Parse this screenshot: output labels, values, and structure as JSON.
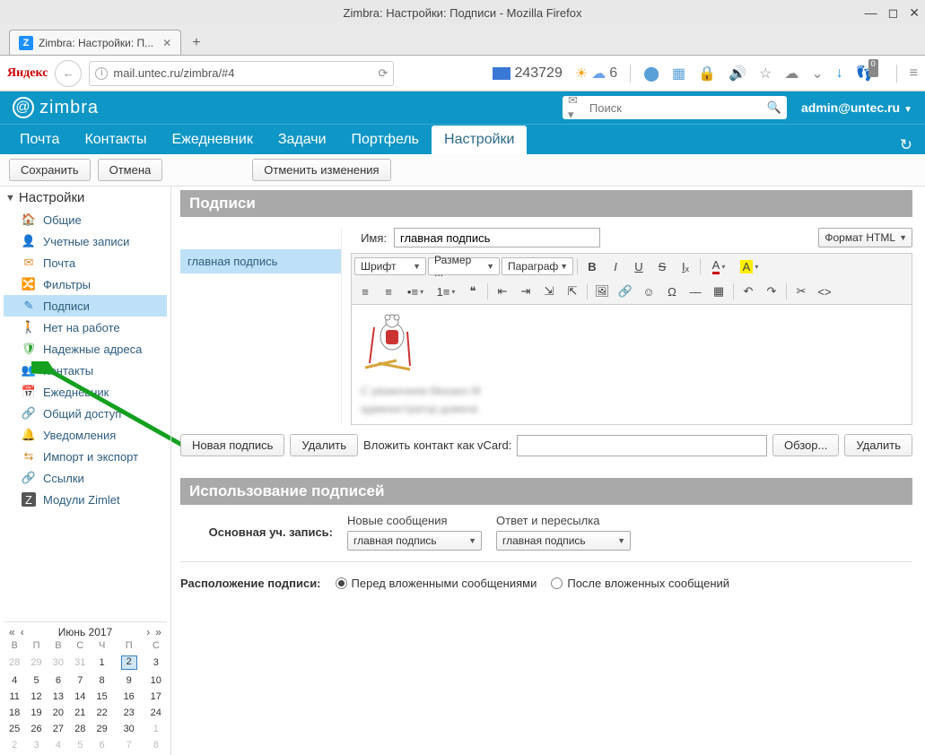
{
  "window": {
    "title": "Zimbra: Настройки: Подписи - Mozilla Firefox"
  },
  "browser": {
    "tab_title": "Zimbra: Настройки: П...",
    "yandex": "Яндекс",
    "url_display": "mail.untec.ru/zimbra/#4",
    "unread_badge": "243729",
    "weather_temp": "6",
    "ext_badge": "0"
  },
  "zimbra": {
    "logo": "zimbra",
    "search_placeholder": "Поиск",
    "user": "admin@untec.ru"
  },
  "nav": {
    "items": [
      "Почта",
      "Контакты",
      "Ежедневник",
      "Задачи",
      "Портфель",
      "Настройки"
    ],
    "active_index": 5
  },
  "actions": {
    "save": "Сохранить",
    "cancel": "Отмена",
    "revert": "Отменить изменения"
  },
  "sidebar": {
    "header": "Настройки",
    "items": [
      "Общие",
      "Учетные записи",
      "Почта",
      "Фильтры",
      "Подписи",
      "Нет на работе",
      "Надежные адреса",
      "Контакты",
      "Ежедневник",
      "Общий доступ",
      "Уведомления",
      "Импорт и экспорт",
      "Ссылки",
      "Модули Zimlet"
    ],
    "selected_index": 4
  },
  "signatures": {
    "section_title": "Подписи",
    "name_label": "Имя:",
    "name_value": "главная подпись",
    "format_select": "Формат HTML",
    "sig_list": [
      "главная подпись"
    ],
    "editor": {
      "font": "Шрифт",
      "size": "Размер ...",
      "paragraph": "Параграф",
      "content_line1": "С уважением Михаил М",
      "content_line2": "администратор домена"
    },
    "new_sig": "Новая подпись",
    "delete": "Удалить",
    "vcard_label": "Вложить контакт как vCard:",
    "browse": "Обзор...",
    "delete2": "Удалить"
  },
  "usage": {
    "section_title": "Использование подписей",
    "col_new": "Новые сообщения",
    "col_reply": "Ответ и пересылка",
    "row_label": "Основная уч. запись:",
    "val_new": "главная подпись",
    "val_reply": "главная подпись",
    "placement_label": "Расположение подписи:",
    "opt_above": "Перед вложенными сообщениями",
    "opt_below": "После вложенных сообщений"
  },
  "calendar": {
    "title": "Июнь 2017",
    "dow": [
      "В",
      "П",
      "В",
      "С",
      "Ч",
      "П",
      "С"
    ],
    "weeks": [
      [
        {
          "d": "28",
          "m": true
        },
        {
          "d": "29",
          "m": true
        },
        {
          "d": "30",
          "m": true
        },
        {
          "d": "31",
          "m": true
        },
        {
          "d": "1"
        },
        {
          "d": "2",
          "today": true
        },
        {
          "d": "3"
        }
      ],
      [
        {
          "d": "4"
        },
        {
          "d": "5"
        },
        {
          "d": "6"
        },
        {
          "d": "7"
        },
        {
          "d": "8"
        },
        {
          "d": "9"
        },
        {
          "d": "10"
        }
      ],
      [
        {
          "d": "11"
        },
        {
          "d": "12"
        },
        {
          "d": "13"
        },
        {
          "d": "14"
        },
        {
          "d": "15"
        },
        {
          "d": "16"
        },
        {
          "d": "17"
        }
      ],
      [
        {
          "d": "18"
        },
        {
          "d": "19"
        },
        {
          "d": "20"
        },
        {
          "d": "21"
        },
        {
          "d": "22"
        },
        {
          "d": "23"
        },
        {
          "d": "24"
        }
      ],
      [
        {
          "d": "25"
        },
        {
          "d": "26"
        },
        {
          "d": "27"
        },
        {
          "d": "28"
        },
        {
          "d": "29"
        },
        {
          "d": "30"
        },
        {
          "d": "1",
          "m": true
        }
      ],
      [
        {
          "d": "2",
          "m": true
        },
        {
          "d": "3",
          "m": true
        },
        {
          "d": "4",
          "m": true
        },
        {
          "d": "5",
          "m": true
        },
        {
          "d": "6",
          "m": true
        },
        {
          "d": "7",
          "m": true
        },
        {
          "d": "8",
          "m": true
        }
      ]
    ]
  }
}
